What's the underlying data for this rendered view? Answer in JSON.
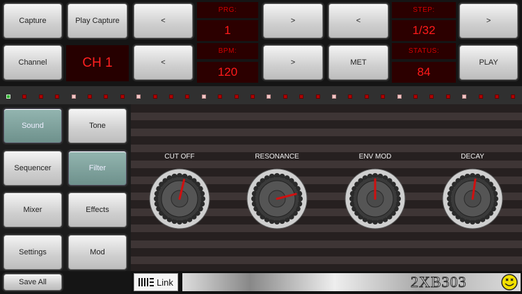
{
  "top": {
    "capture_label": "Capture",
    "play_capture_label": "Play Capture",
    "prg_prev": "<",
    "prg_label": "PRG:",
    "prg_value": "1",
    "prg_next": ">",
    "step_prev": "<",
    "step_label": "STEP:",
    "step_value": "1/32",
    "step_next": ">",
    "channel_label": "Channel",
    "channel_value": "CH 1",
    "bpm_prev": "<",
    "bpm_label": "BPM:",
    "bpm_value": "120",
    "bpm_next": ">",
    "met_label": "MET",
    "status_label": "STATUS:",
    "status_value": "84",
    "play_label": "PLAY"
  },
  "steps": {
    "count": 32,
    "active_index": 0,
    "colors": {
      "active": "#2fb52f",
      "inactive": "#b00000",
      "quarter": "#f2c8c8"
    }
  },
  "sidebar": {
    "items": [
      {
        "label": "Sound",
        "active": true
      },
      {
        "label": "Tone",
        "active": false
      },
      {
        "label": "Sequencer",
        "active": false
      },
      {
        "label": "Filter",
        "active": true
      },
      {
        "label": "Mixer",
        "active": false
      },
      {
        "label": "Effects",
        "active": false
      },
      {
        "label": "Settings",
        "active": false
      },
      {
        "label": "Mod",
        "active": false
      }
    ],
    "save_all_label": "Save All"
  },
  "knobs": [
    {
      "label": "CUT OFF",
      "value_fraction": 0.55
    },
    {
      "label": "RESONANCE",
      "value_fraction": 0.78
    },
    {
      "label": "ENV MOD",
      "value_fraction": 0.5
    },
    {
      "label": "DECAY",
      "value_fraction": 0.53
    }
  ],
  "footer": {
    "link_icon": "link-bars-icon",
    "link_label": "Link",
    "app_name": "2XB303",
    "mascot_icon": "smiley-icon"
  },
  "colors": {
    "lcd_red": "#ff1a1a",
    "active_teal": "#7fa39e"
  }
}
